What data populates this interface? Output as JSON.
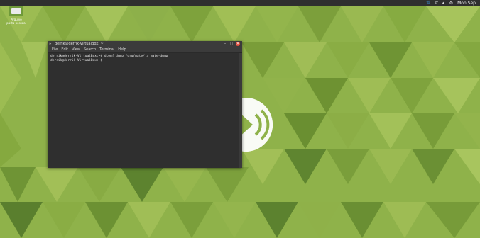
{
  "desktop": {
    "icon_label_1": "Arquivo",
    "icon_label_2": "pasta pessoal"
  },
  "top_panel": {
    "network_icon": "network-icon",
    "sync_icon": "sync-icon",
    "volume_icon": "volume-icon",
    "power_icon": "power-icon",
    "clock": "Mon Sep"
  },
  "terminal": {
    "title": "derrik@derrik-VirtualBox: ~",
    "menu": [
      "File",
      "Edit",
      "View",
      "Search",
      "Terminal",
      "Help"
    ],
    "lines": [
      "derrik@derrik-VirtualBox:~$ dconf dump /org/mate/ > mate-dump",
      "derrik@derrik-VirtualBox:~$ "
    ]
  },
  "colors": {
    "wallpaper": "#8fb24a",
    "panel": "#2f2f2f",
    "terminal_bg": "#2f2f2f",
    "close_button": "#e24b3a"
  }
}
